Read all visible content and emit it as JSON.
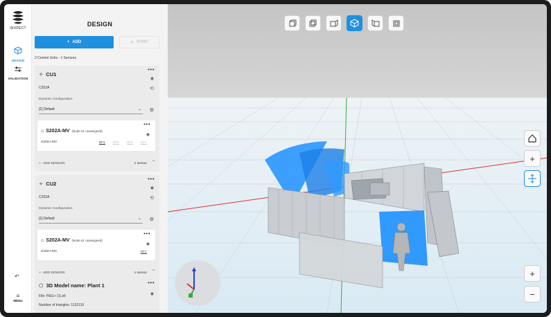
{
  "app": {
    "logo_text": "INXPECT",
    "nav": [
      {
        "label": "DESIGN",
        "icon": "cube-icon",
        "active": true
      },
      {
        "label": "VALIDATION",
        "icon": "sliders-icon",
        "active": false
      }
    ],
    "menu_label": "MENU"
  },
  "panel": {
    "title": "DESIGN",
    "add_label": "ADD",
    "sync_label": "SYNC",
    "summary": "2 Control Units - 1 Sensors",
    "control_units": [
      {
        "name": "CU1",
        "model": "C202A",
        "config_label": "Dynamic Configuration",
        "config_value": "[1] Default",
        "sensor": {
          "name": "S202A-MV",
          "node": "(Node Id: unassigned)",
          "model": "S202A-MV",
          "fields": [
            "DF1",
            "DF2",
            "DF3",
            "DF4"
          ]
        },
        "add_sensor_label": "ADD SENSOR",
        "sensor_count": "1 sensor"
      },
      {
        "name": "CU2",
        "model": "C202A",
        "config_label": "Dynamic Configuration",
        "config_value": "[1] Default",
        "sensor": {
          "name": "S202A-MV",
          "node": "(Node Id: unassigned)",
          "model": "S202A-MV",
          "fields": [
            "DF1"
          ]
        },
        "add_sensor_label": "ADD SENSOR",
        "sensor_count": "1 sensor"
      }
    ],
    "model": {
      "title": "3D Model name: Plant 1",
      "file": "File: P&G-r (1).stl",
      "triangles": "Number of triangles: 1132110"
    }
  },
  "viewport": {
    "toolbar": [
      {
        "icon": "view-cube-front-icon",
        "active": false
      },
      {
        "icon": "view-cube-back-icon",
        "active": false
      },
      {
        "icon": "view-cube-left-icon",
        "active": false
      },
      {
        "icon": "view-cube-iso-icon",
        "active": true
      },
      {
        "icon": "view-cube-right-icon",
        "active": false
      },
      {
        "icon": "view-cube-top-icon",
        "active": false
      }
    ],
    "side_tools": [
      "home-icon",
      "plus-icon",
      "orbit-icon"
    ],
    "zoom_tools": [
      "zoom-in-icon",
      "zoom-out-icon"
    ],
    "colors": {
      "accent": "#1f8fe0",
      "sky": "#c9c9c9",
      "floor": "#e8f2f8",
      "sensor_field": "#1e90ff"
    }
  }
}
